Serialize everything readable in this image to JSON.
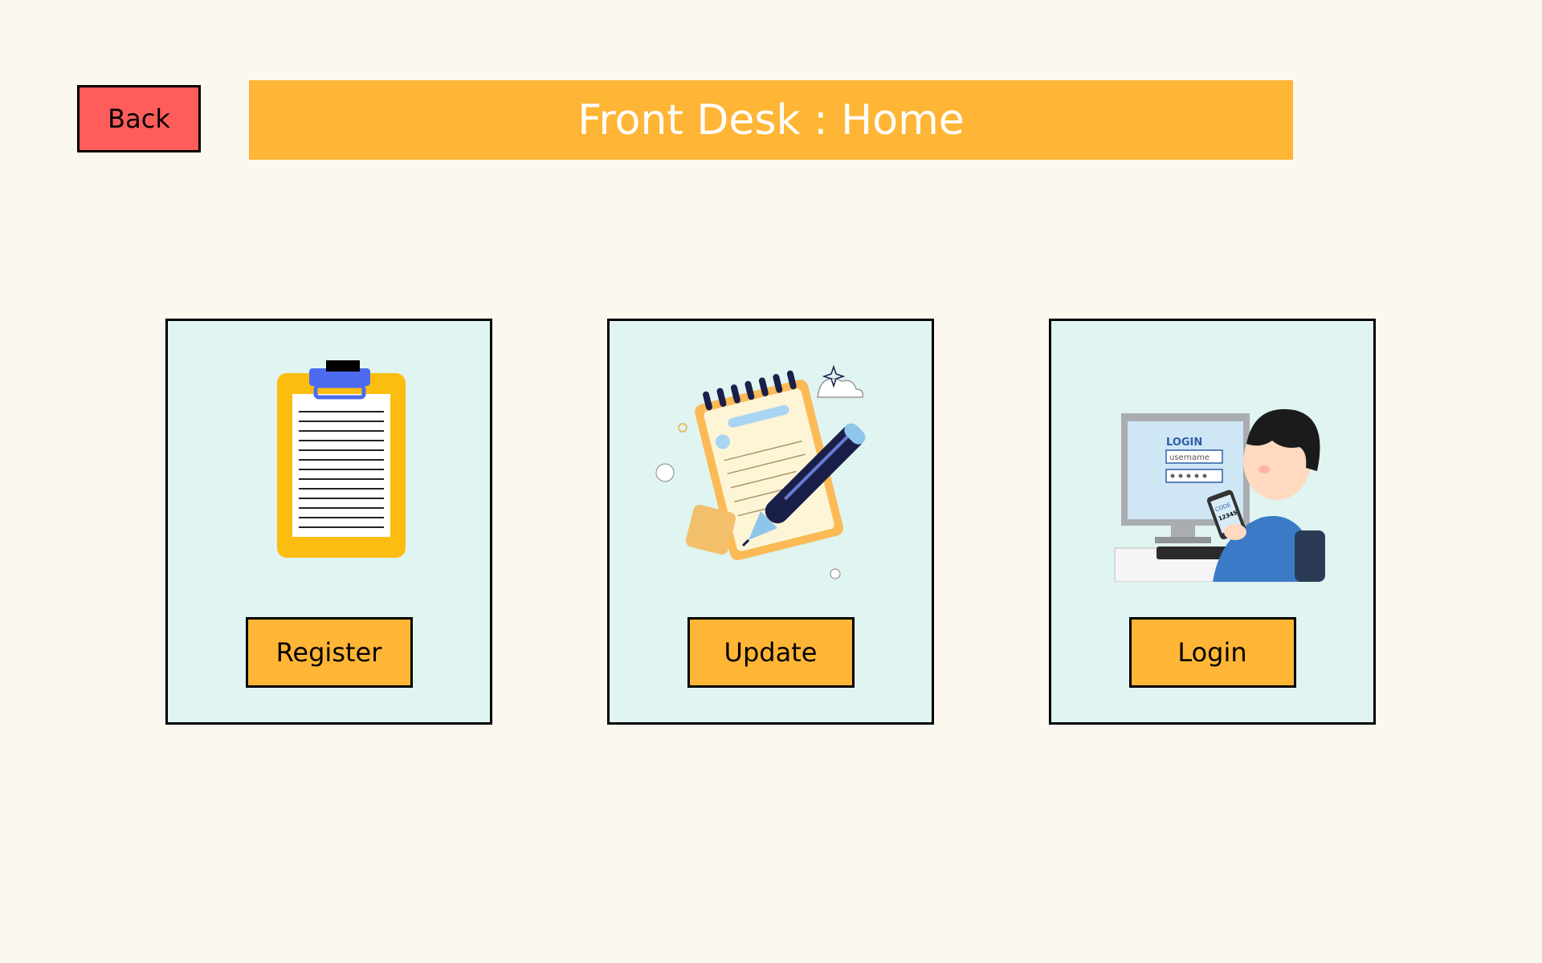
{
  "header": {
    "back_label": "Back",
    "title": "Front Desk : Home"
  },
  "cards": [
    {
      "id": "register",
      "button_label": "Register",
      "icon": "clipboard-icon"
    },
    {
      "id": "update",
      "button_label": "Update",
      "icon": "notepad-pen-icon"
    },
    {
      "id": "login",
      "button_label": "Login",
      "icon": "login-computer-person-icon"
    }
  ],
  "login_illustration": {
    "screen_title": "LOGIN",
    "username_placeholder": "username",
    "phone_code_label": "CODE",
    "phone_code_value": "12345"
  },
  "colors": {
    "background": "#fbf8ef",
    "title_bar": "#ffb535",
    "back_button": "#ff5c5c",
    "card_background": "#e0f4f1",
    "card_button": "#ffb535"
  }
}
